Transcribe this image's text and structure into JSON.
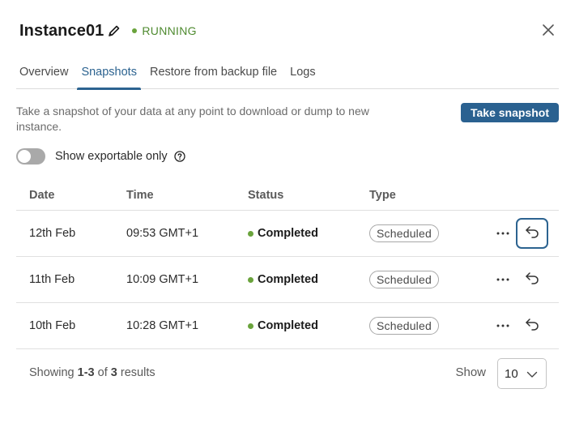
{
  "header": {
    "title": "Instance01",
    "status": "RUNNING",
    "edit_icon": "pencil-icon",
    "close_icon": "close-icon"
  },
  "tabs": [
    {
      "label": "Overview",
      "active": false
    },
    {
      "label": "Snapshots",
      "active": true
    },
    {
      "label": "Restore from backup file",
      "active": false
    },
    {
      "label": "Logs",
      "active": false
    }
  ],
  "snapshots": {
    "description": "Take a snapshot of your data at any point to download or dump to new instance.",
    "take_snapshot_label": "Take snapshot",
    "toggle": {
      "label": "Show exportable only",
      "on": false,
      "help_icon": "question-circle-icon"
    },
    "columns": [
      "Date",
      "Time",
      "Status",
      "Type"
    ],
    "rows": [
      {
        "date": "12th Feb",
        "time": "09:53 GMT+1",
        "status": "Completed",
        "type": "Scheduled"
      },
      {
        "date": "11th Feb",
        "time": "10:09 GMT+1",
        "status": "Completed",
        "type": "Scheduled"
      },
      {
        "date": "10th Feb",
        "time": "10:28 GMT+1",
        "status": "Completed",
        "type": "Scheduled"
      }
    ],
    "row_actions": {
      "more_icon": "more-horizontal-icon",
      "restore_icon": "undo-arrow-icon"
    }
  },
  "pagination": {
    "showing_prefix": "Showing",
    "range": "1-3",
    "of_text": "of",
    "total": "3",
    "suffix": "results",
    "show_label": "Show",
    "page_size": "10"
  },
  "colors": {
    "accent": "#2a6190",
    "running": "#4e8a2f",
    "completed_dot": "#6aa33c"
  }
}
